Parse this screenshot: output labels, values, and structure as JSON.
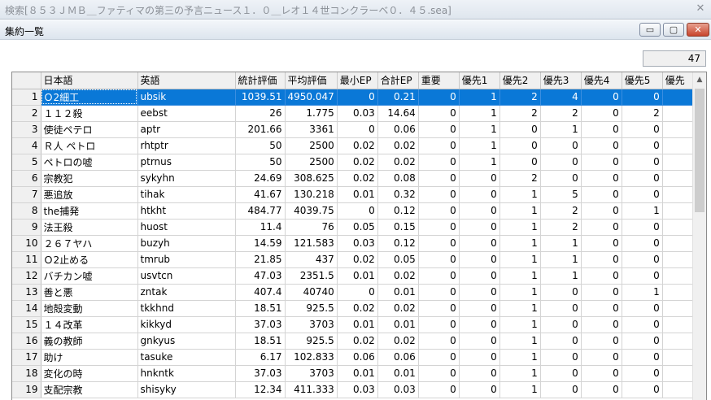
{
  "parent_window": {
    "title": "検索[８５３ＪＭＢ＿ファティマの第三の予言ニュース１．０＿レオ１４世コンクラーベ０．４５.sea]",
    "close": "✕"
  },
  "child_window": {
    "title": "集約一覧",
    "minimize": "▭",
    "maximize": "▢",
    "close": "✕"
  },
  "record_count": "47",
  "grid": {
    "columns": [
      "",
      "日本語",
      "英語",
      "統計評価",
      "平均評価",
      "最小EP",
      "合計EP",
      "重要",
      "優先1",
      "優先2",
      "優先3",
      "優先4",
      "優先5",
      "優先"
    ],
    "selected_row": 0,
    "rows": [
      [
        "1",
        "Ｏ2細工",
        "ubsik",
        "1039.51",
        "4950.047",
        "0",
        "0.21",
        "0",
        "1",
        "2",
        "4",
        "0",
        "0"
      ],
      [
        "2",
        "１１２殺",
        "eebst",
        "26",
        "1.775",
        "0.03",
        "14.64",
        "0",
        "1",
        "2",
        "2",
        "0",
        "2"
      ],
      [
        "3",
        "使徒ペテロ",
        "aptr",
        "201.66",
        "3361",
        "0",
        "0.06",
        "0",
        "1",
        "0",
        "1",
        "0",
        "0"
      ],
      [
        "4",
        "Ｒ人 ペトロ",
        "rhtptr",
        "50",
        "2500",
        "0.02",
        "0.02",
        "0",
        "1",
        "0",
        "0",
        "0",
        "0"
      ],
      [
        "5",
        "ペトロの嘘",
        "ptrnus",
        "50",
        "2500",
        "0.02",
        "0.02",
        "0",
        "1",
        "0",
        "0",
        "0",
        "0"
      ],
      [
        "6",
        "宗教犯",
        "sykyhn",
        "24.69",
        "308.625",
        "0.02",
        "0.08",
        "0",
        "0",
        "2",
        "0",
        "0",
        "0"
      ],
      [
        "7",
        "悪追放",
        "tihak",
        "41.67",
        "130.218",
        "0.01",
        "0.32",
        "0",
        "0",
        "1",
        "5",
        "0",
        "0"
      ],
      [
        "8",
        "the捕発",
        "htkht",
        "484.77",
        "4039.75",
        "0",
        "0.12",
        "0",
        "0",
        "1",
        "2",
        "0",
        "1"
      ],
      [
        "9",
        "法王殺",
        "huost",
        "11.4",
        "76",
        "0.05",
        "0.15",
        "0",
        "0",
        "1",
        "2",
        "0",
        "0"
      ],
      [
        "10",
        "２６７ヤハ",
        "buzyh",
        "14.59",
        "121.583",
        "0.03",
        "0.12",
        "0",
        "0",
        "1",
        "1",
        "0",
        "0"
      ],
      [
        "11",
        "Ｏ2止める",
        "tmrub",
        "21.85",
        "437",
        "0.02",
        "0.05",
        "0",
        "0",
        "1",
        "1",
        "0",
        "0"
      ],
      [
        "12",
        "バチカン嘘",
        "usvtcn",
        "47.03",
        "2351.5",
        "0.01",
        "0.02",
        "0",
        "0",
        "1",
        "1",
        "0",
        "0"
      ],
      [
        "13",
        "善と悪",
        "zntak",
        "407.4",
        "40740",
        "0",
        "0.01",
        "0",
        "0",
        "1",
        "0",
        "0",
        "1"
      ],
      [
        "14",
        "地殻変動",
        "tkkhnd",
        "18.51",
        "925.5",
        "0.02",
        "0.02",
        "0",
        "0",
        "1",
        "0",
        "0",
        "0"
      ],
      [
        "15",
        "１４改革",
        "kikkyd",
        "37.03",
        "3703",
        "0.01",
        "0.01",
        "0",
        "0",
        "1",
        "0",
        "0",
        "0"
      ],
      [
        "16",
        "義の教師",
        "gnkyus",
        "18.51",
        "925.5",
        "0.02",
        "0.02",
        "0",
        "0",
        "1",
        "0",
        "0",
        "0"
      ],
      [
        "17",
        "助け",
        "tasuke",
        "6.17",
        "102.833",
        "0.06",
        "0.06",
        "0",
        "0",
        "1",
        "0",
        "0",
        "0"
      ],
      [
        "18",
        "変化の時",
        "hnkntk",
        "37.03",
        "3703",
        "0.01",
        "0.01",
        "0",
        "0",
        "1",
        "0",
        "0",
        "0"
      ],
      [
        "19",
        "支配宗教",
        "shisyky",
        "12.34",
        "411.333",
        "0.03",
        "0.03",
        "0",
        "0",
        "1",
        "0",
        "0",
        "0"
      ]
    ]
  },
  "scrollbar": {
    "up_arrow": "▲"
  }
}
